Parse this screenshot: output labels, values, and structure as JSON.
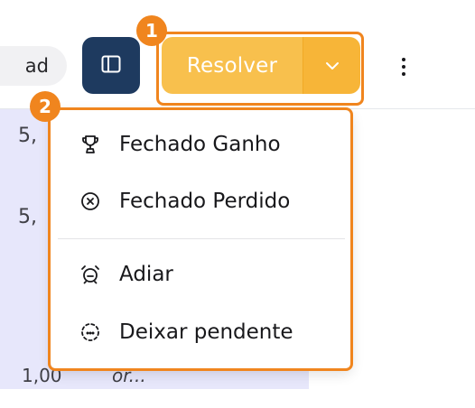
{
  "toolbar": {
    "partial_pill_label": "ad",
    "resolve_label": "Resolver"
  },
  "background_list": {
    "fragments": [
      "5,",
      "5,",
      "1,00",
      "or..."
    ]
  },
  "resolve_menu": {
    "items": [
      {
        "label": "Fechado Ganho",
        "icon": "trophy-icon"
      },
      {
        "label": "Fechado Perdido",
        "icon": "circle-x-icon"
      },
      {
        "label": "Adiar",
        "icon": "alarm-clock-icon"
      },
      {
        "label": "Deixar pendente",
        "icon": "dashed-circle-icon"
      }
    ]
  },
  "annotations": {
    "badges": [
      "1",
      "2"
    ]
  },
  "colors": {
    "resolve_button": "#f8c04d",
    "resolve_caret": "#f7b538",
    "sidebar_button": "#1e3a5f",
    "annotation": "#f0851e",
    "background_column": "#e7e7fb"
  }
}
